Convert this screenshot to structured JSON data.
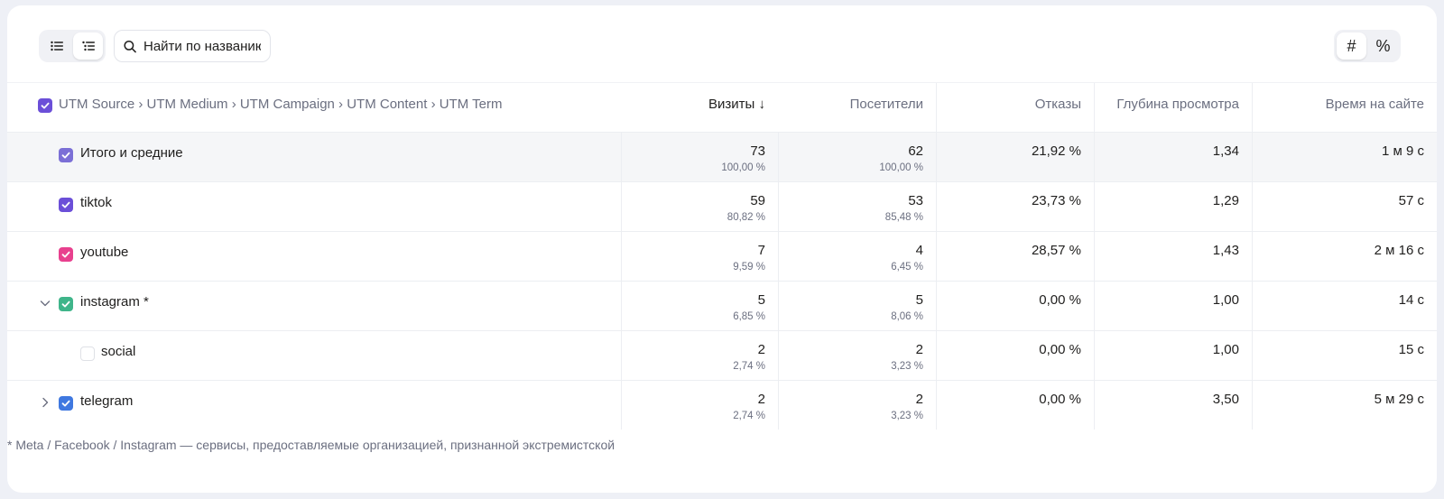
{
  "search": {
    "placeholder": "Найти по названию"
  },
  "unit_toggle": {
    "count_label": "#",
    "percent_label": "%"
  },
  "header": {
    "dimensions": "UTM Source › UTM Medium › UTM Campaign › UTM Content › UTM Term",
    "visits": "Визиты ↓",
    "visitors": "Посетители",
    "bounces": "Отказы",
    "depth": "Глубина просмотра",
    "time": "Время на сайте"
  },
  "colors": {
    "header_checkbox": "#6b4fd8",
    "total": "#7b6fd6",
    "tiktok": "#6b4fd8",
    "youtube": "#e8408e",
    "instagram": "#3fb58a",
    "telegram": "#3f78e0"
  },
  "rows": [
    {
      "label": "Итого и средние",
      "visits": "73",
      "visits_pct": "100,00 %",
      "visitors": "62",
      "visitors_pct": "100,00 %",
      "bounces": "21,92 %",
      "depth": "1,34",
      "time": "1 м 9 с"
    },
    {
      "label": "tiktok",
      "visits": "59",
      "visits_pct": "80,82 %",
      "visitors": "53",
      "visitors_pct": "85,48 %",
      "bounces": "23,73 %",
      "depth": "1,29",
      "time": "57 с"
    },
    {
      "label": "youtube",
      "visits": "7",
      "visits_pct": "9,59 %",
      "visitors": "4",
      "visitors_pct": "6,45 %",
      "bounces": "28,57 %",
      "depth": "1,43",
      "time": "2 м 16 с"
    },
    {
      "label": "instagram *",
      "visits": "5",
      "visits_pct": "6,85 %",
      "visitors": "5",
      "visitors_pct": "8,06 %",
      "bounces": "0,00 %",
      "depth": "1,00",
      "time": "14 с"
    },
    {
      "label": "social",
      "visits": "2",
      "visits_pct": "2,74 %",
      "visitors": "2",
      "visitors_pct": "3,23 %",
      "bounces": "0,00 %",
      "depth": "1,00",
      "time": "15 с"
    },
    {
      "label": "telegram",
      "visits": "2",
      "visits_pct": "2,74 %",
      "visitors": "2",
      "visitors_pct": "3,23 %",
      "bounces": "0,00 %",
      "depth": "3,50",
      "time": "5 м 29 с"
    }
  ],
  "footnote": "* Meta / Facebook / Instagram — сервисы, предоставляемые организацией, признанной экстремистской"
}
